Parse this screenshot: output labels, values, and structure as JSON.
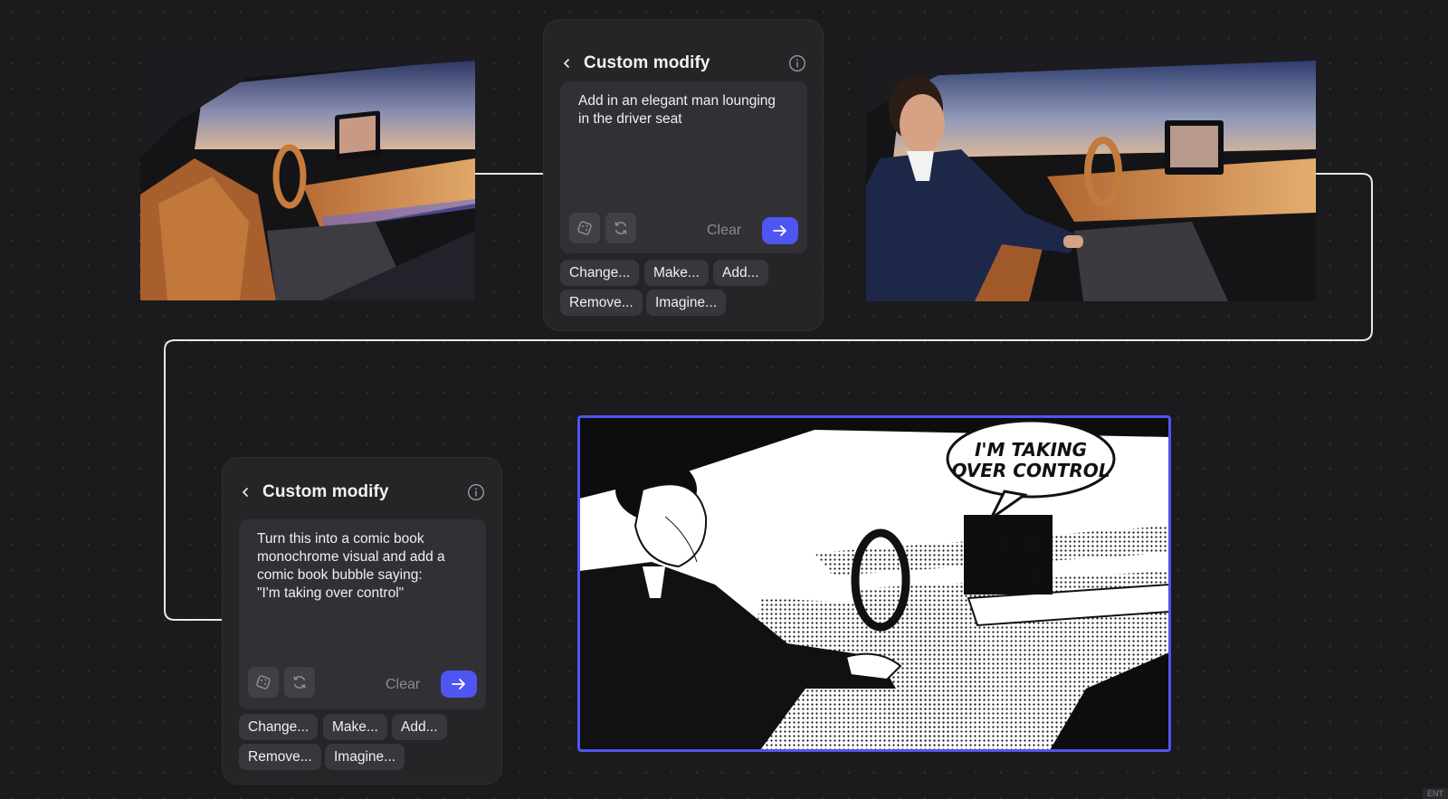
{
  "panels": [
    {
      "title": "Custom modify",
      "prompt": "Add in an elegant man lounging\nin the driver seat",
      "clear_label": "Clear",
      "chips": [
        "Change...",
        "Make...",
        "Add...",
        "Remove...",
        "Imagine..."
      ]
    },
    {
      "title": "Custom modify",
      "prompt": "Turn this into a comic book\nmonochrome visual and add a\ncomic book bubble saying:\n\"I'm taking over control\"",
      "clear_label": "Clear",
      "chips": [
        "Change...",
        "Make...",
        "Add...",
        "Remove...",
        "Imagine..."
      ]
    }
  ],
  "images": {
    "original": {
      "subject": "car interior at dusk"
    },
    "modified": {
      "subject": "man in driver seat"
    },
    "comic": {
      "speech_bubble": "I'M TAKING\nOVER CONTROL"
    }
  },
  "icons": [
    "chevron-left-icon",
    "info-icon",
    "dice-icon",
    "refresh-icon",
    "arrow-right-icon"
  ],
  "colors": {
    "accent": "#4f55f0",
    "canvas": "#1b1b1d",
    "panel": "#252528"
  },
  "corner_tag": "ENT"
}
